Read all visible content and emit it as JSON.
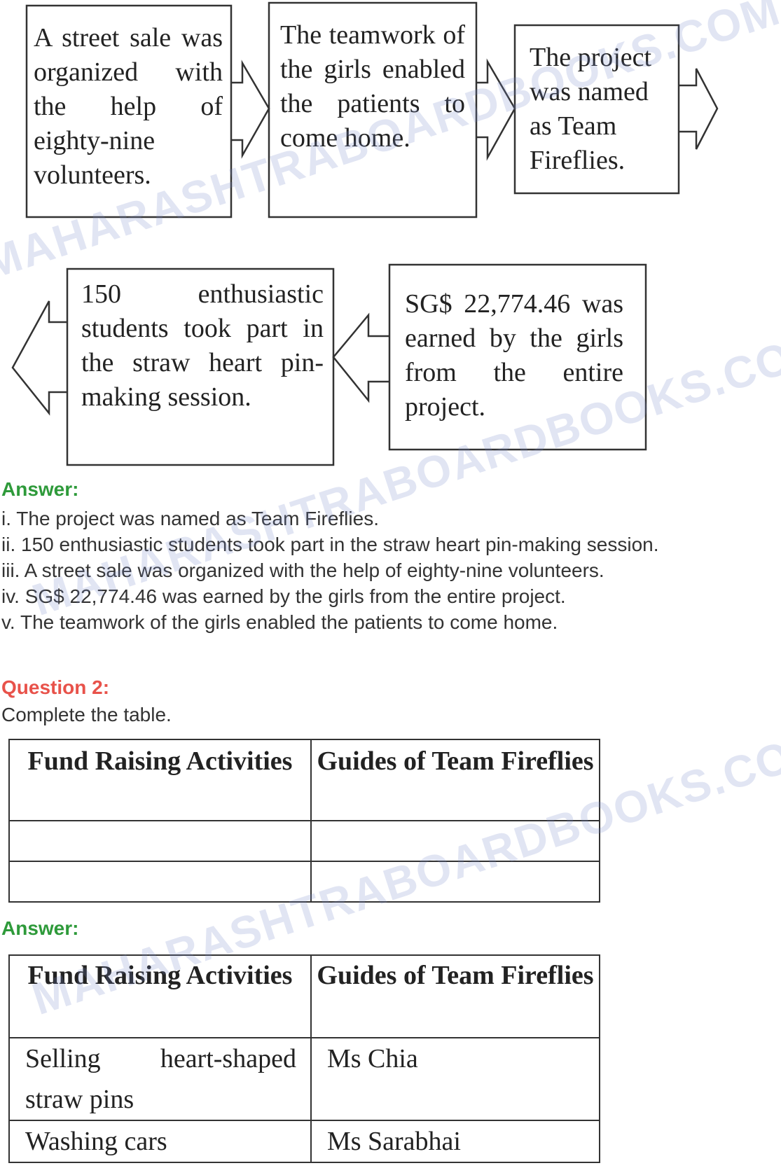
{
  "flowchart": {
    "boxes": [
      {
        "id": "box-street-sale",
        "text": "A street sale was organized with the help of eighty-nine volunteers."
      },
      {
        "id": "box-teamwork",
        "text": "The teamwork of the girls enabled the patients to come home."
      },
      {
        "id": "box-project-name",
        "text": "The project was named as Team Fireflies."
      },
      {
        "id": "box-students",
        "text": "150 enthusiastic students took part in the straw heart pin-making session."
      },
      {
        "id": "box-money",
        "text": "SG$ 22,774.46 was earned by the girls from the entire project."
      }
    ],
    "arrows": [
      "arrow-right",
      "arrow-right",
      "arrow-right",
      "arrow-left",
      "arrow-left"
    ]
  },
  "answer1": {
    "label": "Answer:",
    "items": [
      "i. The project was named as Team Fireflies.",
      "ii. 150 enthusiastic students took part in the straw heart pin-making session.",
      "iii. A street sale was organized with the help of eighty-nine volunteers.",
      "iv. SG$ 22,774.46 was earned by the girls from the entire project.",
      "v. The teamwork of the girls enabled the patients to come home."
    ]
  },
  "question2": {
    "label": "Question 2:",
    "prompt": "Complete the table.",
    "table": {
      "headers": [
        "Fund Raising Activities",
        "Guides of Team Fireflies"
      ],
      "rows": [
        [
          "",
          ""
        ],
        [
          "",
          ""
        ]
      ]
    }
  },
  "answer2": {
    "label": "Answer:",
    "table": {
      "headers": [
        "Fund Raising Activities",
        "Guides of Team Fireflies"
      ],
      "rows": [
        [
          "Selling heart-shaped straw pins",
          "Ms Chia"
        ],
        [
          "Washing cars",
          "Ms Sarabhai"
        ]
      ]
    }
  },
  "watermark": "MAHARASHTRABOARDBOOKS.COM",
  "colors": {
    "answer_label": "#2e9a3a",
    "question_label": "#e8524a"
  }
}
